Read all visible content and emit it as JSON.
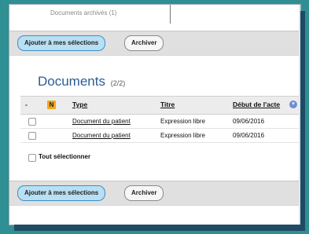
{
  "tab": {
    "archived_label": "Documents archivés (1)"
  },
  "toolbar": {
    "add_label": "Ajouter à mes sélections",
    "archive_label": "Archiver"
  },
  "section": {
    "title": "Documents",
    "count": "(2/2)"
  },
  "table": {
    "headers": {
      "dash": "-",
      "n_icon": "N",
      "type": "Type",
      "titre": "Titre",
      "debut": "Début de l'acte"
    },
    "rows": [
      {
        "type": "Document du patient",
        "titre": "Expression libre",
        "date": "09/06/2016"
      },
      {
        "type": "Document du patient",
        "titre": "Expression libre",
        "date": "09/06/2016"
      }
    ]
  },
  "select_all": {
    "label": "Tout sélectionner"
  },
  "colors": {
    "accent": "#2a5d95",
    "primary_button": "#b8dff2",
    "n_badge": "#f3a71a",
    "background": "#2f8f92"
  }
}
